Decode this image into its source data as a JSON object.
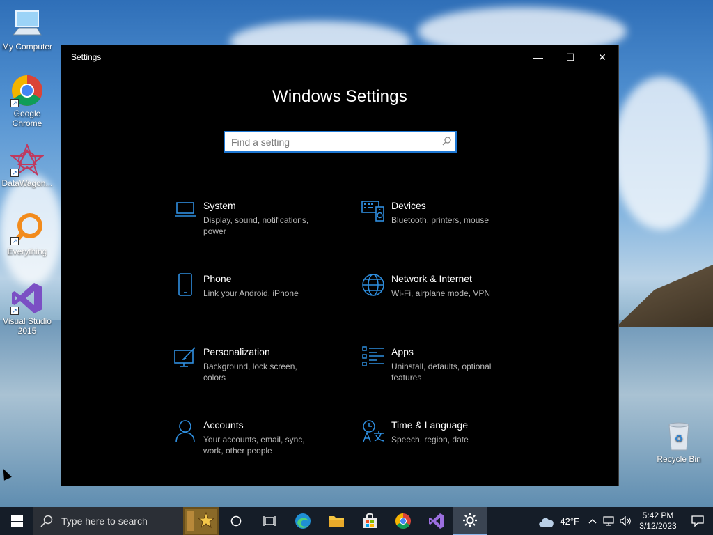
{
  "desktop": {
    "icons": [
      {
        "label": "My Computer"
      },
      {
        "label": "Google Chrome"
      },
      {
        "label": "DataWagon..."
      },
      {
        "label": "Everything"
      },
      {
        "label": "Visual Studio 2015"
      },
      {
        "label": "Recycle Bin"
      }
    ]
  },
  "window": {
    "title": "Settings",
    "minimize_glyph": "—",
    "maximize_glyph": "☐",
    "close_glyph": "✕",
    "heading": "Windows Settings",
    "search": {
      "value": "",
      "placeholder": "Find a setting"
    },
    "tiles": [
      {
        "name": "System",
        "desc": "Display, sound, notifications, power",
        "icon": "laptop-icon"
      },
      {
        "name": "Devices",
        "desc": "Bluetooth, printers, mouse",
        "icon": "keyboard-speaker-icon"
      },
      {
        "name": "Phone",
        "desc": "Link your Android, iPhone",
        "icon": "phone-icon"
      },
      {
        "name": "Network & Internet",
        "desc": "Wi-Fi, airplane mode, VPN",
        "icon": "globe-icon"
      },
      {
        "name": "Personalization",
        "desc": "Background, lock screen, colors",
        "icon": "paint-monitor-icon"
      },
      {
        "name": "Apps",
        "desc": "Uninstall, defaults, optional features",
        "icon": "apps-list-icon"
      },
      {
        "name": "Accounts",
        "desc": "Your accounts, email, sync, work, other people",
        "icon": "person-icon"
      },
      {
        "name": "Time & Language",
        "desc": "Speech, region, date",
        "icon": "time-language-icon"
      }
    ],
    "accent_color": "#1e78d4"
  },
  "taskbar": {
    "search_placeholder": "Type here to search",
    "weather": "42°F",
    "time": "5:42 PM",
    "date": "3/12/2023"
  }
}
